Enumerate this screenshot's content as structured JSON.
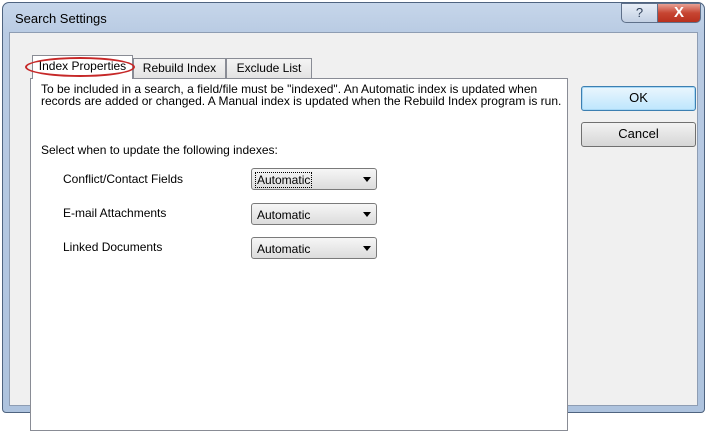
{
  "window": {
    "title": "Search Settings"
  },
  "titlebar": {
    "help_glyph": "?",
    "close_glyph": "X",
    "help_icon": "help-icon",
    "close_icon": "close-icon"
  },
  "tabs": [
    {
      "label": "Index Properties",
      "active": true,
      "highlighted": true
    },
    {
      "label": "Rebuild Index",
      "active": false
    },
    {
      "label": "Exclude List",
      "active": false
    }
  ],
  "panel": {
    "description": "To be included in a search, a field/file must be \"indexed\".  An Automatic index is updated when records are added or changed.  A Manual index is updated when the Rebuild Index program is run.",
    "select_label": "Select when to update the following indexes:",
    "rows": [
      {
        "label": "Conflict/Contact Fields",
        "value": "Automatic"
      },
      {
        "label": "E-mail Attachments",
        "value": "Automatic"
      },
      {
        "label": "Linked Documents",
        "value": "Automatic"
      }
    ]
  },
  "buttons": {
    "ok": "OK",
    "cancel": "Cancel"
  },
  "colors": {
    "highlight_ellipse": "#c62828",
    "title_bar": "#b9cbe3",
    "close_button": "#c74532"
  }
}
